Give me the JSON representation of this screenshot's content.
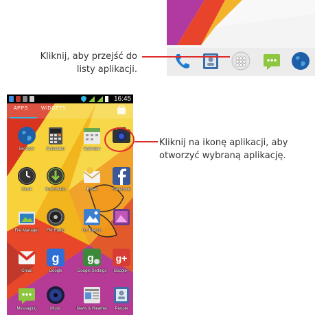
{
  "annotations": {
    "top_line1": "Kliknij, aby przejść do",
    "top_line2": "listy aplikacji.",
    "right_line1": "Kliknij na ikonę aplikacji, aby",
    "right_line2": "otworzyć wybraną aplikację."
  },
  "dock": {
    "items": [
      {
        "name": "phone-icon"
      },
      {
        "name": "contacts-icon"
      },
      {
        "name": "app-drawer-icon"
      },
      {
        "name": "messaging-icon"
      },
      {
        "name": "browser-icon"
      }
    ]
  },
  "statusbar": {
    "time": "16:45"
  },
  "tabs": {
    "apps": "APPS",
    "widgets": "WIDGETS"
  },
  "apps": [
    {
      "label": "Browser",
      "icon": "globe-icon"
    },
    {
      "label": "Calculator",
      "icon": "calculator-icon"
    },
    {
      "label": "Calendar",
      "icon": "calendar-icon"
    },
    {
      "label": "",
      "icon": "camera-icon"
    },
    {
      "label": "Clock",
      "icon": "clock-icon"
    },
    {
      "label": "Downloads",
      "icon": "download-icon"
    },
    {
      "label": "Email",
      "icon": "email-icon"
    },
    {
      "label": "Facebook",
      "icon": "facebook-icon"
    },
    {
      "label": "File Manager",
      "icon": "folder-icon"
    },
    {
      "label": "FM Radio",
      "icon": "radio-icon"
    },
    {
      "label": "G+ Photos",
      "icon": "photos-icon"
    },
    {
      "label": "",
      "icon": "gallery-icon"
    },
    {
      "label": "Gmail",
      "icon": "gmail-icon"
    },
    {
      "label": "Google",
      "icon": "google-icon"
    },
    {
      "label": "Google Settings",
      "icon": "google-settings-icon"
    },
    {
      "label": "Google+",
      "icon": "google-plus-icon"
    },
    {
      "label": "Messaging",
      "icon": "messaging-icon"
    },
    {
      "label": "Music",
      "icon": "music-icon"
    },
    {
      "label": "News & Weather",
      "icon": "news-icon"
    },
    {
      "label": "People",
      "icon": "people-icon"
    }
  ],
  "colors": {
    "highlight": "#e02b2b",
    "accent": "#33b5e5"
  }
}
